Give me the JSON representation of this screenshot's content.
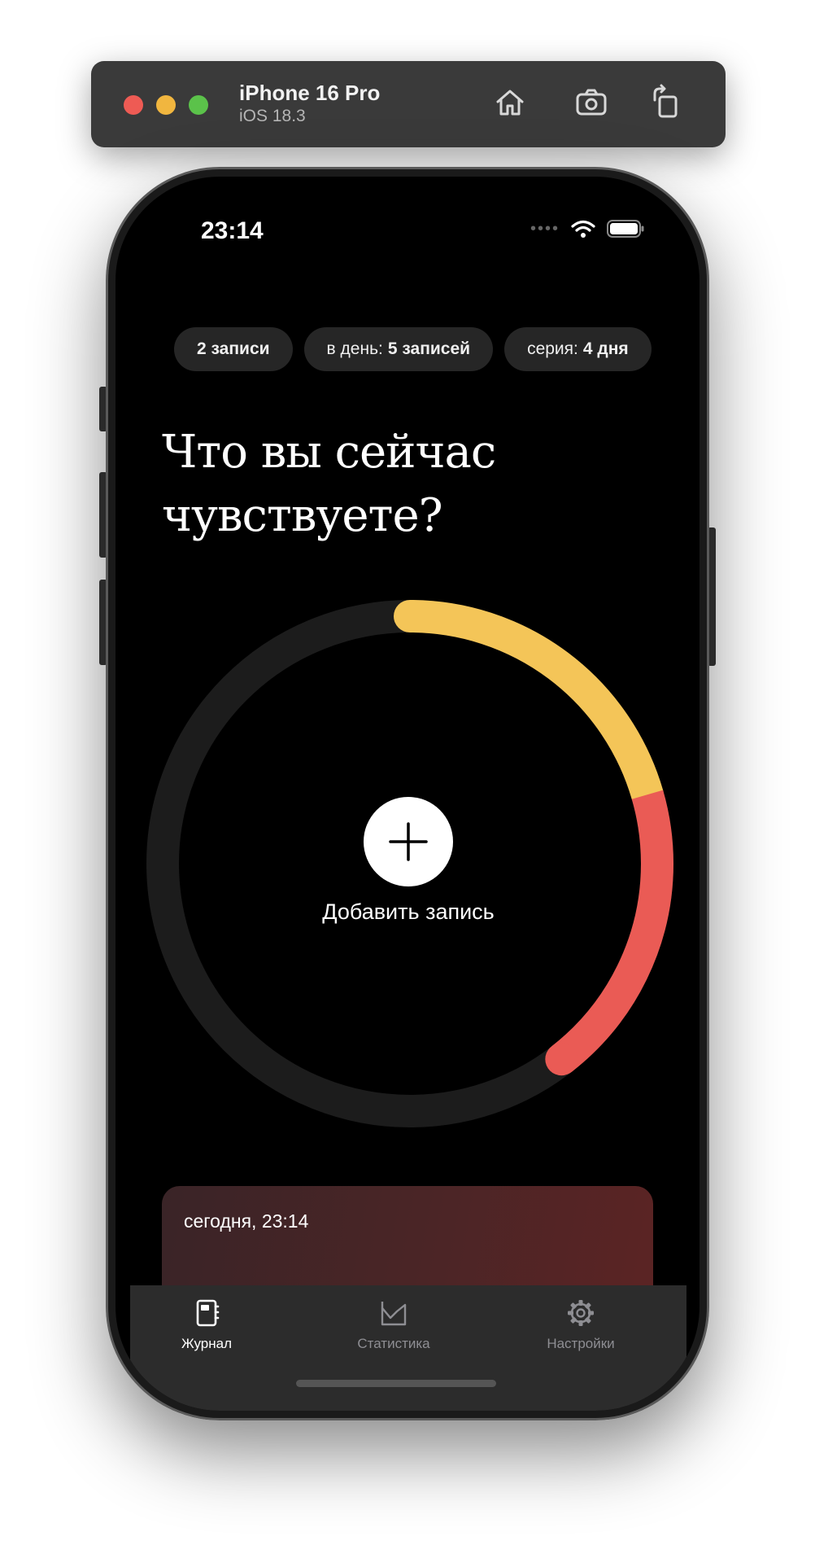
{
  "simulator": {
    "device_name": "iPhone 16 Pro",
    "os_version": "iOS 18.3",
    "buttons": [
      "home-icon",
      "camera-icon",
      "rotate-icon"
    ]
  },
  "status_bar": {
    "time": "23:14",
    "icons": [
      "signal-icon",
      "wifi-icon",
      "battery-icon"
    ]
  },
  "stats": {
    "entries": "2 записи",
    "per_day_prefix": "в день:",
    "per_day_value": "5 записей",
    "streak_prefix": "серия:",
    "streak_value": "4 дня"
  },
  "headline": {
    "line1": "Что вы сейчас",
    "line2": "чувствуете?"
  },
  "mood_ring": {
    "track_color": "#1c1c1c",
    "segments": [
      {
        "color": "#f4c558",
        "share": 0.205
      },
      {
        "color": "#ea5b55",
        "share": 0.19
      }
    ]
  },
  "add_entry": {
    "label": "Добавить запись",
    "icon": "plus-icon"
  },
  "entry_card": {
    "date": "сегодня, 23:14"
  },
  "tabbar": {
    "tabs": [
      {
        "label": "Журнал",
        "icon": "journal-icon",
        "active": true
      },
      {
        "label": "Статистика",
        "icon": "chart-icon",
        "active": false
      },
      {
        "label": "Настройки",
        "icon": "gear-icon",
        "active": false
      }
    ]
  }
}
